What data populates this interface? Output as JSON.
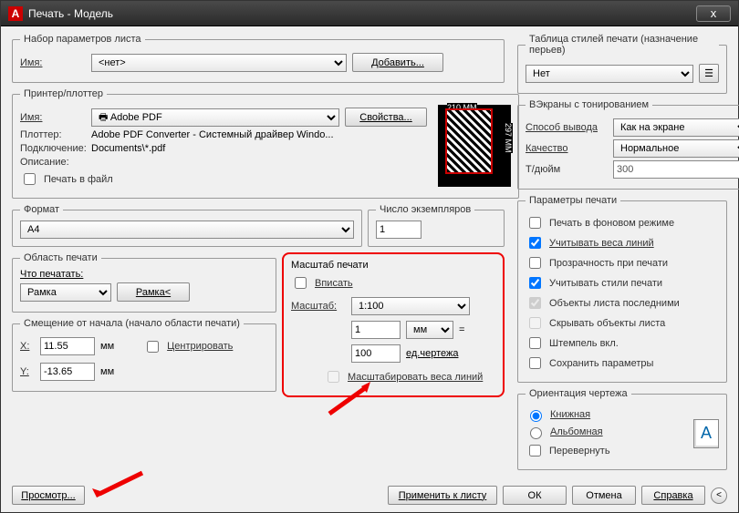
{
  "titlebar": {
    "app_icon": "A",
    "title": "Печать - Модель",
    "close": "x"
  },
  "page_setup": {
    "legend": "Набор параметров листа",
    "name_label": "Имя:",
    "name_value": "<нет>",
    "add_btn": "Добавить..."
  },
  "printer": {
    "legend": "Принтер/плоттер",
    "name_label": "Имя:",
    "name_value": "Adobe PDF",
    "props_btn": "Свойства...",
    "plotter_label": "Плоттер:",
    "plotter_value": "Adobe PDF Converter - Системный драйвер Windo...",
    "where_label": "Подключение:",
    "where_value": "Documents\\*.pdf",
    "desc_label": "Описание:",
    "to_file_label": "Печать в файл",
    "preview_top": "210 MM",
    "preview_right": "297 MM"
  },
  "format": {
    "legend": "Формат",
    "value": "A4"
  },
  "copies": {
    "legend": "Число экземпляров",
    "value": "1"
  },
  "area": {
    "legend": "Область печати",
    "what_label": "Что печатать:",
    "what_value": "Рамка",
    "window_btn": "Рамка<"
  },
  "scale": {
    "legend": "Масштаб печати",
    "fit_label": "Вписать",
    "scale_label": "Масштаб:",
    "scale_value": "1:100",
    "units_value": "1",
    "units_unit": "мм",
    "equals": "=",
    "drawing_value": "100",
    "drawing_unit": "ед.чертежа",
    "scale_lw_label": "Масштабировать веса линий"
  },
  "offset": {
    "legend": "Смещение от начала (начало области печати)",
    "x_label": "X:",
    "x_value": "11.55",
    "x_unit": "мм",
    "center_label": "Центрировать",
    "y_label": "Y:",
    "y_value": "-13.65",
    "y_unit": "мм"
  },
  "plot_style": {
    "legend": "Таблица стилей печати (назначение перьев)",
    "value": "Нет"
  },
  "shade": {
    "legend": "ВЭкраны с тонированием",
    "method_label": "Способ вывода",
    "method_value": "Как на экране",
    "quality_label": "Качество",
    "quality_value": "Нормальное",
    "dpi_label": "Т/дюйм",
    "dpi_value": "300"
  },
  "options": {
    "legend": "Параметры печати",
    "bg": "Печать в фоновом режиме",
    "lw": "Учитывать веса линий",
    "transp": "Прозрачность при печати",
    "styles": "Учитывать стили печати",
    "last": "Объекты листа последними",
    "hide": "Скрывать объекты листа",
    "stamp": "Штемпель вкл.",
    "save": "Сохранить параметры"
  },
  "orient": {
    "legend": "Ориентация чертежа",
    "portrait": "Книжная",
    "landscape": "Альбомная",
    "upside": "Перевернуть",
    "icon_text": "A"
  },
  "buttons": {
    "preview": "Просмотр...",
    "apply": "Применить к листу",
    "ok": "ОК",
    "cancel": "Отмена",
    "help": "Справка",
    "expand": "<"
  }
}
